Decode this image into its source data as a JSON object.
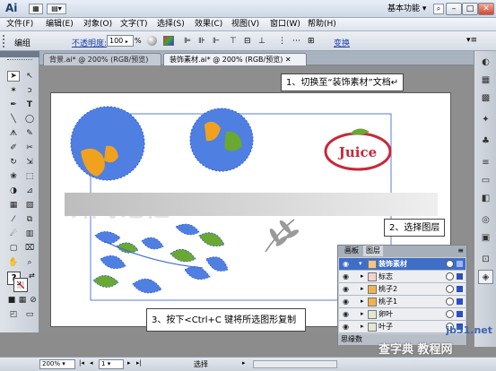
{
  "app": {
    "logo": "Ai",
    "workspace": "基本功能"
  },
  "menu": [
    "文件(F)",
    "编辑(E)",
    "对象(O)",
    "文字(T)",
    "选择(S)",
    "效果(C)",
    "视图(V)",
    "窗口(W)",
    "帮助(H)"
  ],
  "control_bar": {
    "group_label": "编组",
    "opacity_label": "不透明度:",
    "opacity_value": "100",
    "opacity_unit": "%",
    "transform_label": "变换"
  },
  "doc_tabs": [
    {
      "label": "背景.ai* @ 200% (RGB/预览)",
      "active": false
    },
    {
      "label": "装饰素材.ai* @ 200% (RGB/预览)",
      "active": true
    }
  ],
  "artwork": {
    "logo_text": "Juice",
    "faded_text": "瞬间记忆"
  },
  "callouts": {
    "step1": "1、切换至“装饰素材”文档↵",
    "step2": "2、选择图层",
    "step3": "3、按下<Ctrl+C 键将所选图形复制"
  },
  "layers_panel": {
    "tabs": [
      "画板",
      "图层"
    ],
    "rows": [
      {
        "name": "装饰素材",
        "selected": true,
        "expanded": true
      },
      {
        "name": "标志",
        "selected": false
      },
      {
        "name": "桃子2",
        "selected": false
      },
      {
        "name": "桃子1",
        "selected": false
      },
      {
        "name": "卵叶",
        "selected": false
      },
      {
        "name": "叶子",
        "selected": false
      }
    ],
    "footer": "思缘数"
  },
  "status": {
    "zoom": "200%",
    "page": "1",
    "mode": "选择"
  },
  "watermark": {
    "line1": "jb51.net",
    "line2": "查字典 教程网",
    "line3": "jiaocheng.chazidian.com"
  },
  "colors": {
    "blue": "#4f7fe0",
    "orange": "#f0a21e",
    "green": "#6aa832",
    "selection": "#2f5ae0"
  }
}
